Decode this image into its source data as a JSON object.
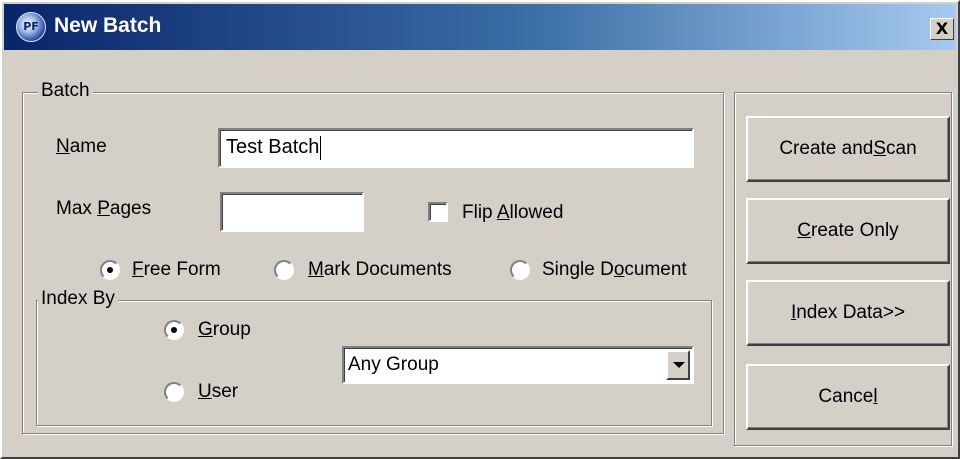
{
  "window": {
    "title": "New Batch",
    "icon_text": "PF",
    "close_symbol": "X"
  },
  "batch_group": {
    "legend": "Batch",
    "name_label": {
      "mnemonic": "N",
      "rest": "ame"
    },
    "name_value": "Test Batch",
    "max_pages_label": {
      "before": "Max ",
      "mnemonic": "P",
      "rest": "ages"
    },
    "max_pages_value": "",
    "flip_allowed": {
      "before": "Flip ",
      "mnemonic": "A",
      "rest": "llowed",
      "checked": false
    },
    "mode_options": [
      {
        "mnemonic": "F",
        "rest": "ree Form",
        "selected": true
      },
      {
        "mnemonic": "M",
        "rest": "ark Documents",
        "selected": false
      },
      {
        "before": "Single D",
        "mnemonic": "o",
        "rest": "cument",
        "selected": false
      }
    ]
  },
  "index_by_group": {
    "legend": "Index By",
    "options": [
      {
        "mnemonic": "G",
        "rest": "roup",
        "selected": true
      },
      {
        "mnemonic": "U",
        "rest": "ser",
        "selected": false
      }
    ],
    "group_select_value": "Any Group"
  },
  "buttons": {
    "create_and_scan": {
      "before": "Create and ",
      "mnemonic": "S",
      "rest": "can"
    },
    "create_only": {
      "mnemonic": "C",
      "rest": "reate Only"
    },
    "index_data": {
      "mnemonic": "I",
      "rest": "ndex Data>>"
    },
    "cancel": {
      "before": "Cance",
      "mnemonic": "l",
      "rest": ""
    }
  },
  "colors": {
    "dialog_face": "#d4d0c8",
    "title_gradient_start": "#0a246a",
    "title_gradient_end": "#a6caf0"
  },
  "icons": [
    "app-logo-icon",
    "close-icon",
    "dropdown-arrow-icon"
  ]
}
